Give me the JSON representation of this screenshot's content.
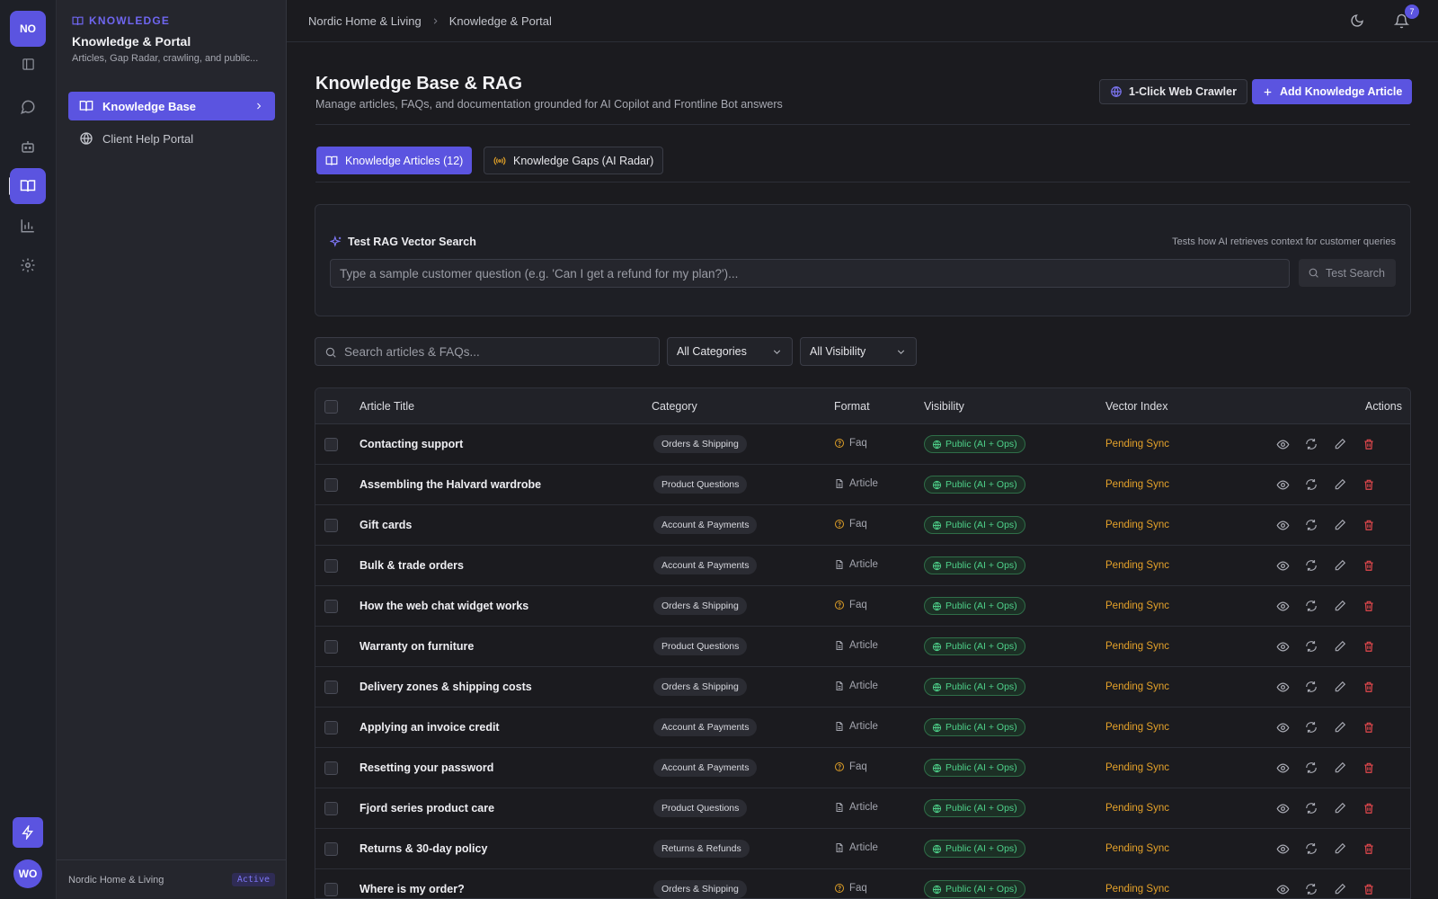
{
  "rail": {
    "workspace_badge": "NO",
    "user_avatar": "WO",
    "items": [
      {
        "icon": "panel-toggle-icon"
      },
      {
        "icon": "chat-bubble-icon"
      },
      {
        "icon": "bot-icon"
      },
      {
        "icon": "book-open-icon",
        "active": true
      },
      {
        "icon": "bar-chart-icon"
      },
      {
        "icon": "gear-icon"
      }
    ],
    "bottom_action_icon": "lightning-icon"
  },
  "sidebar": {
    "eyebrow": "KNOWLEDGE",
    "title": "Knowledge & Portal",
    "subtitle": "Articles, Gap Radar, crawling, and public...",
    "items": [
      {
        "label": "Knowledge Base",
        "icon": "book-open-icon",
        "active": true
      },
      {
        "label": "Client Help Portal",
        "icon": "globe-icon",
        "active": false
      }
    ],
    "footer": {
      "org": "Nordic Home & Living",
      "status": "Active"
    }
  },
  "topbar": {
    "breadcrumb": [
      "Nordic Home & Living",
      "Knowledge & Portal"
    ],
    "notification_count": "7"
  },
  "page": {
    "title": "Knowledge Base & RAG",
    "subtitle": "Manage articles, FAQs, and documentation grounded for AI Copilot and Frontline Bot answers",
    "crawler_button": "1-Click Web Crawler",
    "add_button": "Add Knowledge Article"
  },
  "tabs": [
    {
      "label": "Knowledge Articles (12)",
      "active": true
    },
    {
      "label": "Knowledge Gaps (AI Radar)",
      "active": false
    }
  ],
  "rag": {
    "title": "Test RAG Vector Search",
    "hint": "Tests how AI retrieves context for customer queries",
    "placeholder": "Type a sample customer question (e.g. 'Can I get a refund for my plan?')...",
    "button": "Test Search"
  },
  "filters": {
    "search_placeholder": "Search articles & FAQs...",
    "category": "All Categories",
    "visibility": "All Visibility"
  },
  "table": {
    "columns": [
      "Article Title",
      "Category",
      "Format",
      "Visibility",
      "Vector Index",
      "Actions"
    ],
    "rows": [
      {
        "title": "Contacting support",
        "category": "Orders & Shipping",
        "format": "Faq",
        "visibility": "Public (AI + Ops)",
        "index": "Pending Sync"
      },
      {
        "title": "Assembling the Halvard wardrobe",
        "category": "Product Questions",
        "format": "Article",
        "visibility": "Public (AI + Ops)",
        "index": "Pending Sync"
      },
      {
        "title": "Gift cards",
        "category": "Account & Payments",
        "format": "Faq",
        "visibility": "Public (AI + Ops)",
        "index": "Pending Sync"
      },
      {
        "title": "Bulk & trade orders",
        "category": "Account & Payments",
        "format": "Article",
        "visibility": "Public (AI + Ops)",
        "index": "Pending Sync"
      },
      {
        "title": "How the web chat widget works",
        "category": "Orders & Shipping",
        "format": "Faq",
        "visibility": "Public (AI + Ops)",
        "index": "Pending Sync"
      },
      {
        "title": "Warranty on furniture",
        "category": "Product Questions",
        "format": "Article",
        "visibility": "Public (AI + Ops)",
        "index": "Pending Sync"
      },
      {
        "title": "Delivery zones & shipping costs",
        "category": "Orders & Shipping",
        "format": "Article",
        "visibility": "Public (AI + Ops)",
        "index": "Pending Sync"
      },
      {
        "title": "Applying an invoice credit",
        "category": "Account & Payments",
        "format": "Article",
        "visibility": "Public (AI + Ops)",
        "index": "Pending Sync"
      },
      {
        "title": "Resetting your password",
        "category": "Account & Payments",
        "format": "Faq",
        "visibility": "Public (AI + Ops)",
        "index": "Pending Sync"
      },
      {
        "title": "Fjord series product care",
        "category": "Product Questions",
        "format": "Article",
        "visibility": "Public (AI + Ops)",
        "index": "Pending Sync"
      },
      {
        "title": "Returns & 30-day policy",
        "category": "Returns & Refunds",
        "format": "Article",
        "visibility": "Public (AI + Ops)",
        "index": "Pending Sync"
      },
      {
        "title": "Where is my order?",
        "category": "Orders & Shipping",
        "format": "Faq",
        "visibility": "Public (AI + Ops)",
        "index": "Pending Sync"
      }
    ]
  },
  "colors": {
    "accent": "#5b54e0",
    "background": "#1b1b1f",
    "public_green": "#4ed18a",
    "pending_amber": "#e5a22a",
    "faq_amber": "#e0a028",
    "delete_red": "#e5484d"
  }
}
